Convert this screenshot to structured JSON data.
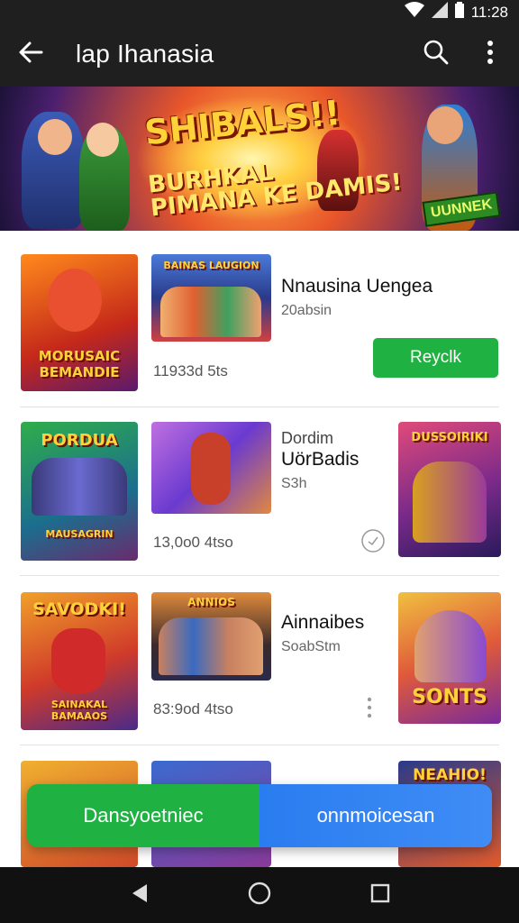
{
  "status_bar": {
    "time": "11:28"
  },
  "app_bar": {
    "title": "lap Ihanasia"
  },
  "banner": {
    "title": "SHIBALS!!",
    "subtitle_line1": "BURHKAL",
    "subtitle_line2": "PIMANA KE DAMIS!",
    "tag": "UUNNEK"
  },
  "rows": [
    {
      "thumb1_text": "MORUSAIC BEMANDIE",
      "thumb2_text": "BAINAS LAUGION",
      "title": "Nnausina Uengea",
      "subtitle": "20absin",
      "meta": "11933d 5ts",
      "action_label": "Reyclk"
    },
    {
      "thumb1_text": "PORDUA",
      "thumb1_caption": "MAUSAGRIN",
      "overline": "Dordim",
      "title": "UörBadis",
      "subtitle": "S3h",
      "meta": "13,0o0 4tso",
      "thumb3_text": "DUSSOIRIKI"
    },
    {
      "thumb1_text": "SAVODKI!",
      "thumb1_caption": "SAINAKAL BAMAAOS",
      "thumb2_text": "ANNIOS",
      "title": "Ainnaibes",
      "subtitle": "SoabStm",
      "meta": "83:9od 4tso",
      "thumb3_text": "SONTS"
    },
    {
      "thumb3_text": "NEAHIO!"
    }
  ],
  "fab": {
    "left_label": "Dansyoetniec",
    "right_label": "onnmoicesan"
  },
  "colors": {
    "app_bar": "#1f1f1f",
    "accent_green": "#1fb141",
    "accent_blue": "#2a7df0"
  },
  "icons": [
    "wifi-icon",
    "signal-icon",
    "battery-icon",
    "back-arrow-icon",
    "search-icon",
    "more-vert-icon",
    "check-circle-icon",
    "nav-back-icon",
    "nav-home-icon",
    "nav-recents-icon"
  ]
}
